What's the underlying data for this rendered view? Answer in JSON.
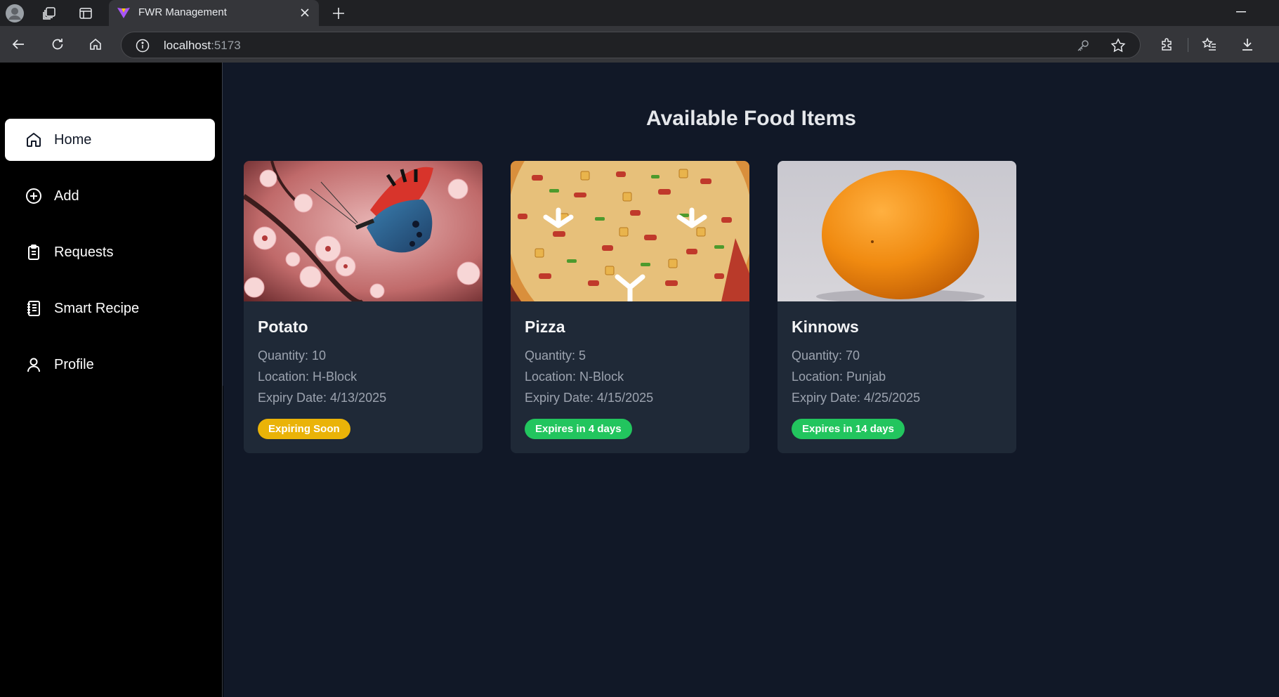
{
  "browser": {
    "tab_title": "FWR Management",
    "url_host": "localhost",
    "url_port": ":5173"
  },
  "sidebar": {
    "items": [
      {
        "label": "Home",
        "icon": "home-icon",
        "active": true
      },
      {
        "label": "Add",
        "icon": "plus-circle-icon",
        "active": false
      },
      {
        "label": "Requests",
        "icon": "clipboard-icon",
        "active": false
      },
      {
        "label": "Smart Recipe",
        "icon": "recipe-book-icon",
        "active": false
      },
      {
        "label": "Profile",
        "icon": "user-icon",
        "active": false
      }
    ]
  },
  "main": {
    "title": "Available Food Items",
    "cards": [
      {
        "name": "Potato",
        "quantity": "Quantity: 10",
        "location": "Location: H-Block",
        "expiry": "Expiry Date: 4/13/2025",
        "badge": "Expiring Soon",
        "badge_color": "#eab308",
        "image": "butterfly-on-blossom-image"
      },
      {
        "name": "Pizza",
        "quantity": "Quantity: 5",
        "location": "Location: N-Block",
        "expiry": "Expiry Date: 4/15/2025",
        "badge": "Expires in 4 days",
        "badge_color": "#22c55e",
        "image": "pizza-image"
      },
      {
        "name": "Kinnows",
        "quantity": "Quantity: 70",
        "location": "Location: Punjab",
        "expiry": "Expiry Date: 4/25/2025",
        "badge": "Expires in 14 days",
        "badge_color": "#22c55e",
        "image": "orange-image"
      }
    ]
  },
  "colors": {
    "page_bg": "#111827",
    "card_bg": "#1f2937",
    "sidebar_bg": "#000000",
    "active_nav_bg": "#ffffff"
  }
}
